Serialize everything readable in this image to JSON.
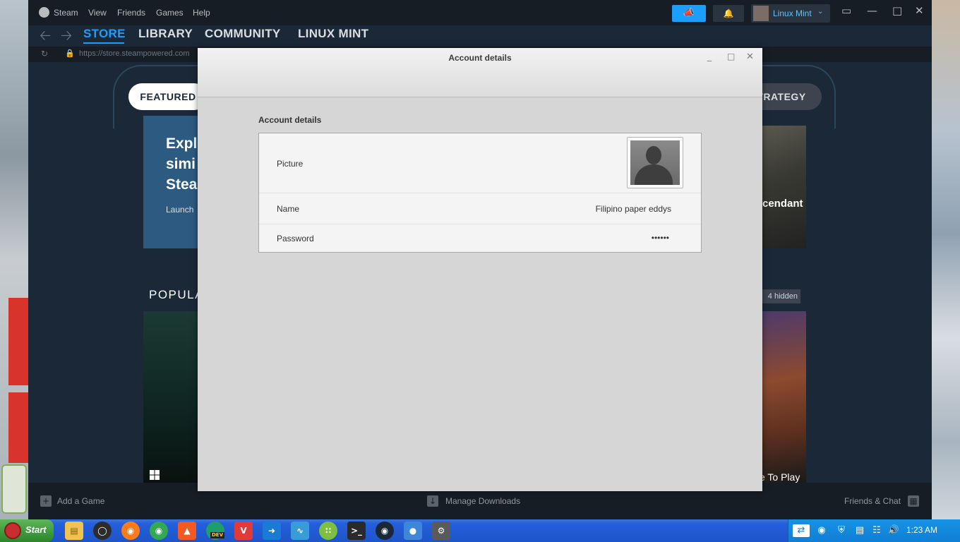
{
  "steam": {
    "menu": [
      "Steam",
      "View",
      "Friends",
      "Games",
      "Help"
    ],
    "user_name": "Linux Mint",
    "nav_tabs": [
      "STORE",
      "LIBRARY",
      "COMMUNITY",
      "LINUX MINT"
    ],
    "url": "https://store.steampowered.com",
    "pill_featured": "FEATURED",
    "pill_strategy": "TRATEGY",
    "hero_lines": [
      "Expl",
      "simi",
      "Stea"
    ],
    "hero_sub": "Launch",
    "hero_right_text": "cendant",
    "popular_label": "POPULA",
    "hidden_badge": "4 hidden",
    "game_right_text": "e To Play",
    "bottom": {
      "add_game": "Add a Game",
      "manage_downloads": "Manage Downloads",
      "friends_chat": "Friends & Chat"
    }
  },
  "dialog": {
    "window_title": "Account details",
    "section_heading": "Account details",
    "rows": {
      "picture_label": "Picture",
      "name_label": "Name",
      "name_value": "Filipino paper eddys",
      "password_label": "Password",
      "password_value": "••••••"
    }
  },
  "taskbar": {
    "start_label": "Start",
    "clock": "1:23 AM",
    "apps": [
      "files",
      "obs",
      "firefox",
      "chrome",
      "brave",
      "edge-dev",
      "vivaldi",
      "flowblade",
      "system-monitor",
      "calculator",
      "terminal",
      "steam",
      "users",
      "settings"
    ],
    "dev_badge": "DEV"
  }
}
